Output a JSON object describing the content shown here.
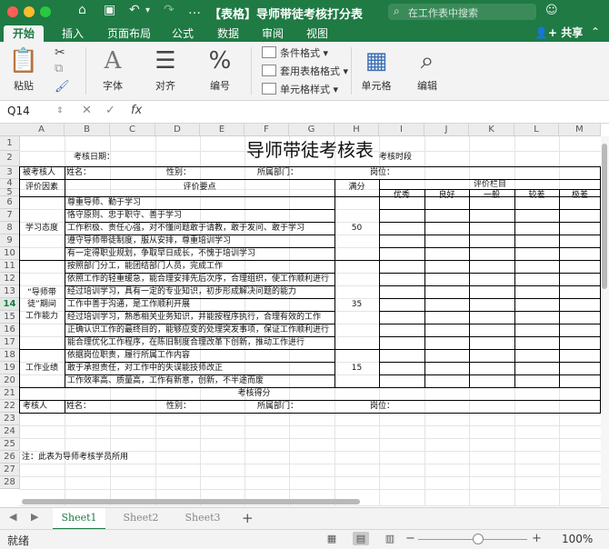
{
  "window": {
    "title": "【表格】导师带徒考核打分表",
    "search_placeholder": "在工作表中搜索",
    "share_label": "共享",
    "colors": {
      "brand": "#1f7a44",
      "close": "#fe5f57",
      "minimize": "#febc2e",
      "zoom": "#28c840"
    }
  },
  "tabs": [
    "开始",
    "插入",
    "页面布局",
    "公式",
    "数据",
    "审阅",
    "视图"
  ],
  "ribbon": {
    "paste": "粘贴",
    "font": "字体",
    "align": "对齐",
    "number": "编号",
    "conditional_format": "条件格式",
    "table_format": "套用表格格式",
    "cell_style": "单元格样式",
    "cells": "单元格",
    "edit": "编辑",
    "number_glyph": "%",
    "font_glyph": "A",
    "func_glyph": "fx"
  },
  "formula_bar": {
    "name_box": "Q14",
    "formula": ""
  },
  "columns": [
    "A",
    "B",
    "C",
    "D",
    "E",
    "F",
    "G",
    "H",
    "I",
    "J",
    "K",
    "L",
    "M"
  ],
  "rows": [
    "1",
    "2",
    "3",
    "4",
    "5",
    "6",
    "7",
    "8",
    "9",
    "10",
    "11",
    "12",
    "13",
    "14",
    "15",
    "16",
    "17",
    "18",
    "19",
    "20",
    "21",
    "22",
    "23",
    "24",
    "25",
    "26",
    "27",
    "28"
  ],
  "selected_row": "14",
  "sheet": {
    "title": "导师带徒考核表",
    "r2": {
      "date": "考核日期：",
      "period": "考核时段"
    },
    "r3": {
      "person": "被考核人",
      "name": "姓名：",
      "gender": "性别：",
      "dept": "所属部门：",
      "post": "岗位："
    },
    "header": {
      "factor": "评价因素",
      "points": "评价要点",
      "full": "满分",
      "col_title": "评价栏目",
      "grades": [
        "优秀",
        "良好",
        "一般",
        "较差",
        "极差"
      ]
    },
    "groups": [
      {
        "name_lines": [
          "学习态度"
        ],
        "score": "50",
        "items": [
          "尊重导师、勤于学习",
          "恪守原则、忠于职守、善于学习",
          "工作积极、责任心强，对不懂问题敢于请教，敢于发问、敢于学习",
          "遵守导师带徒制度，服从安排，尊重培训学习",
          "有一定得职业规划，争取早日成长，不愧于培训学习"
        ]
      },
      {
        "name_lines": [
          "“导师带",
          "徒”期间",
          "工作能力"
        ],
        "score": "35",
        "items": [
          "按照部门分工，能团结部门人员，完成工作",
          "依照工作的轻重缓急，能合理安排先后次序，合理组织，使工作顺利进行",
          "经过培训学习，具有一定的专业知识，初步形成解决问题的能力",
          "工作中善于沟通，是工作顺利开展",
          "经过培训学习，熟悉相关业务知识，并能按程序执行，合理有效的工作",
          "正确认识工作的最终目的，能够应变的处理突发事项，保证工作顺利进行",
          "能合理优化工作程序，在陈旧制度合理改革下创新，推动工作进行"
        ]
      },
      {
        "name_lines": [
          "工作业绩"
        ],
        "score": "15",
        "items": [
          "依据岗位职责，履行所属工作内容",
          "敢于承担责任，对工作中的失误能技师改正",
          "工作效率高、质量高，工作有新意，创新，不半途而废"
        ]
      }
    ],
    "r21": "考核得分",
    "r22": {
      "person": "考核人",
      "name": "姓名：",
      "gender": "性别：",
      "dept": "所属部门：",
      "post": "岗位："
    },
    "note": "注：此表为导师考核学员所用"
  },
  "sheets": [
    "Sheet1",
    "Sheet2",
    "Sheet3"
  ],
  "active_sheet": "Sheet1",
  "status": {
    "ready": "就绪",
    "zoom": "100%"
  }
}
